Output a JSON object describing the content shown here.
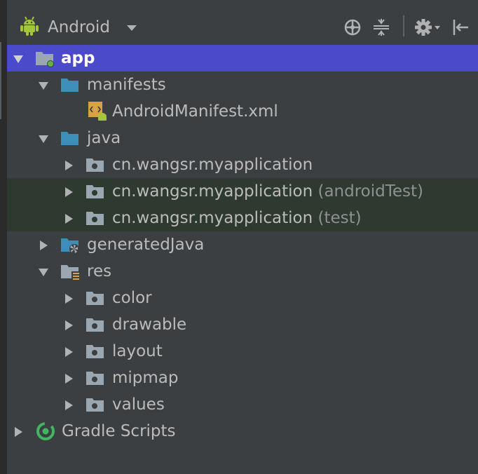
{
  "toolbar": {
    "view_label": "Android",
    "icons": [
      "android-icon",
      "dropdown-caret-icon",
      "locate-icon",
      "collapse-all-icon",
      "gear-icon",
      "hide-panel-icon"
    ]
  },
  "tree": {
    "app": "app",
    "manifests": "manifests",
    "android_manifest": "AndroidManifest.xml",
    "java": "java",
    "pkg_main": "cn.wangsr.myapplication",
    "pkg_android_test": "cn.wangsr.myapplication",
    "pkg_android_test_suffix": "(androidTest)",
    "pkg_test": "cn.wangsr.myapplication",
    "pkg_test_suffix": "(test)",
    "generated_java": "generatedJava",
    "res": "res",
    "color": "color",
    "drawable": "drawable",
    "layout": "layout",
    "mipmap": "mipmap",
    "values": "values",
    "gradle_scripts": "Gradle Scripts"
  },
  "colors": {
    "background": "#3c3f41",
    "selection": "#4b4acb",
    "test_highlight": "#2e3a2f",
    "text": "#bbbbbb",
    "android_green": "#a4c639",
    "folder_blue": "#3d8fba"
  }
}
